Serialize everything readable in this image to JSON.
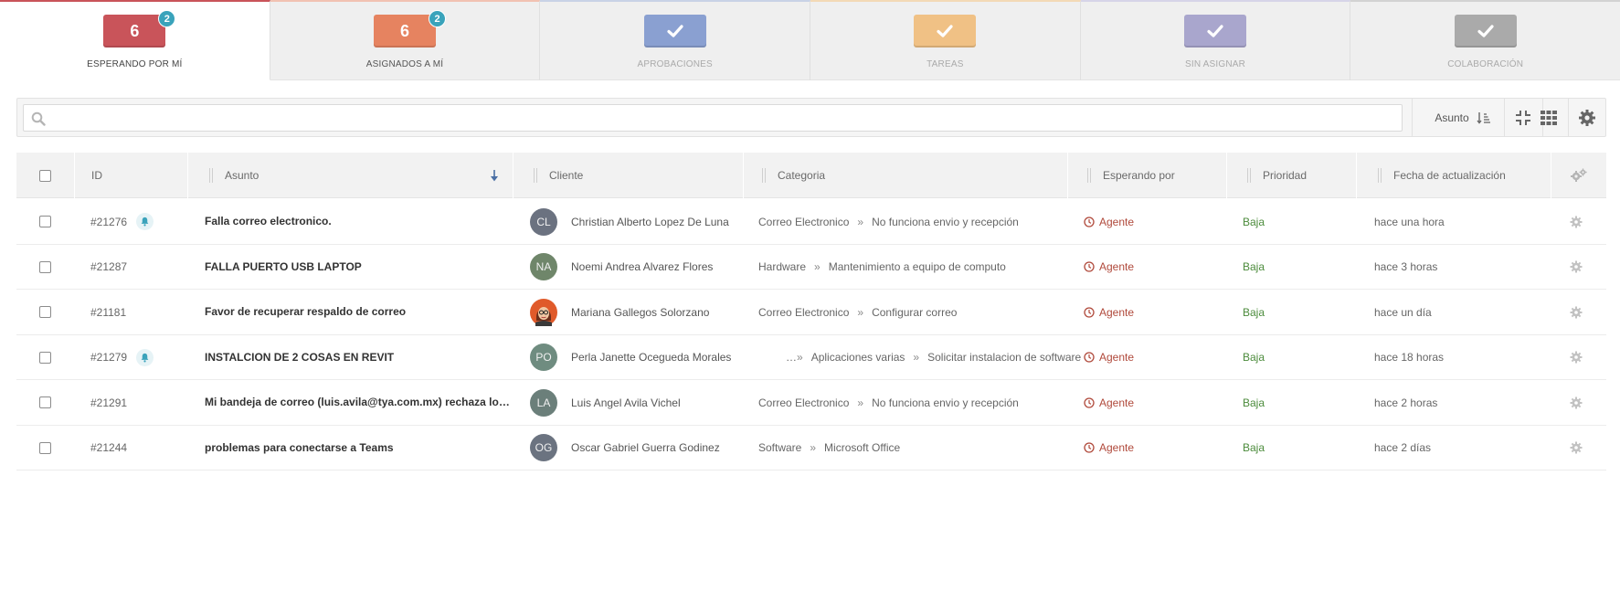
{
  "tabs": [
    {
      "label": "ESPERANDO POR MÍ",
      "count": "6",
      "badge": "2",
      "color": "#c9545a",
      "label_color": "#444444",
      "accent": "#c9545a"
    },
    {
      "label": "ASIGNADOS A MÍ",
      "count": "6",
      "badge": "2",
      "color": "#e68360",
      "label_color": "#555555",
      "accent": "#f1c2b2"
    },
    {
      "label": "APROBACIONES",
      "icon": "check-icon",
      "color": "#8aa0d1",
      "label_color": "#aaaaaa",
      "accent": "#c9d2e6"
    },
    {
      "label": "TAREAS",
      "icon": "check-icon",
      "color": "#f0c185",
      "label_color": "#aaaaaa",
      "accent": "#f3d9b6"
    },
    {
      "label": "SIN ASIGNAR",
      "icon": "check-icon",
      "color": "#a9a6cd",
      "label_color": "#aaaaaa",
      "accent": "#d6d4e8"
    },
    {
      "label": "COLABORACIÓN",
      "icon": "check-icon",
      "color": "#aaaaaa",
      "label_color": "#aaaaaa",
      "accent": "#d2d2d2"
    }
  ],
  "toolbar": {
    "search_value": "",
    "search_placeholder": "",
    "sort_label": "Asunto",
    "icons": [
      "search-icon",
      "sort-icon",
      "compress-icon",
      "grid-icon",
      "settings-icon"
    ]
  },
  "table": {
    "headers": {
      "id": "ID",
      "subject": "Asunto",
      "client": "Cliente",
      "category": "Categoria",
      "waiting": "Esperando por",
      "priority": "Prioridad",
      "updated": "Fecha de actualización"
    },
    "rows": [
      {
        "id": "#21276",
        "bell": true,
        "subject": "Falla correo electronico.",
        "initials": "CL",
        "avatar_color": "#6b7280",
        "client": "Christian Alberto Lopez De Luna",
        "category": [
          "Correo Electronico",
          "No funciona envio y recepción"
        ],
        "cat_ellipsis": false,
        "waiting": "Agente",
        "priority": "Baja",
        "updated": "hace una hora"
      },
      {
        "id": "#21287",
        "bell": false,
        "subject": "FALLA PUERTO USB LAPTOP",
        "initials": "NA",
        "avatar_color": "#6f866a",
        "client": "Noemi Andrea Alvarez Flores",
        "category": [
          "Hardware",
          "Mantenimiento a equipo de computo"
        ],
        "cat_ellipsis": false,
        "waiting": "Agente",
        "priority": "Baja",
        "updated": "hace 3 horas"
      },
      {
        "id": "#21181",
        "bell": false,
        "subject": "Favor de recuperar respaldo de correo",
        "initials": "",
        "avatar_image": true,
        "avatar_color": "#d9603b",
        "client": "Mariana Gallegos Solorzano",
        "category": [
          "Correo Electronico",
          "Configurar correo"
        ],
        "cat_ellipsis": false,
        "waiting": "Agente",
        "priority": "Baja",
        "updated": "hace un día"
      },
      {
        "id": "#21279",
        "bell": true,
        "subject": "INSTALCION DE 2 COSAS EN REVIT",
        "initials": "PO",
        "avatar_color": "#6f8c80",
        "client": "Perla Janette Ocegueda Morales",
        "category": [
          "Aplicaciones varias",
          "Solicitar instalacion de software"
        ],
        "cat_ellipsis": true,
        "ellipsis_text": "…",
        "waiting": "Agente",
        "priority": "Baja",
        "updated": "hace 18 horas"
      },
      {
        "id": "#21291",
        "bell": false,
        "subject": "Mi bandeja de correo (luis.avila@tya.com.mx) rechaza los correos",
        "initials": "LA",
        "avatar_color": "#6b7f7a",
        "client": "Luis Angel Avila Vichel",
        "category": [
          "Correo Electronico",
          "No funciona envio y recepción"
        ],
        "cat_ellipsis": false,
        "waiting": "Agente",
        "priority": "Baja",
        "updated": "hace 2 horas"
      },
      {
        "id": "#21244",
        "bell": false,
        "subject": "problemas para conectarse a Teams",
        "initials": "OG",
        "avatar_color": "#6b7380",
        "client": "Oscar Gabriel Guerra Godinez",
        "category": [
          "Software",
          "Microsoft Office"
        ],
        "cat_ellipsis": false,
        "waiting": "Agente",
        "priority": "Baja",
        "updated": "hace 2 días"
      }
    ],
    "category_separator": "»"
  },
  "colors": {
    "waiting": "#b0493b",
    "priority_low": "#4b8b3b",
    "badge": "#3aa3bb"
  }
}
